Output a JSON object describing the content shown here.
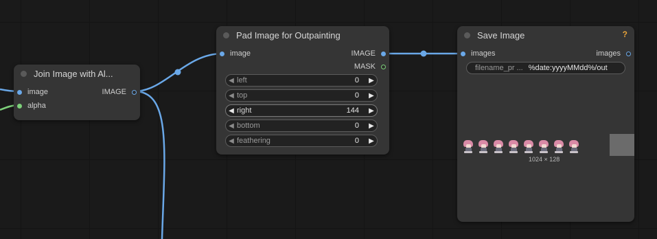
{
  "nodes": {
    "join": {
      "title": "Join Image with Al...",
      "inputs": [
        {
          "name": "image",
          "color": "#6aa8e8"
        },
        {
          "name": "alpha",
          "color": "#7dd07a"
        }
      ],
      "outputs": [
        {
          "name": "IMAGE",
          "color": "#6aa8e8"
        }
      ]
    },
    "pad": {
      "title": "Pad Image for Outpainting",
      "inputs": [
        {
          "name": "image",
          "color": "#6aa8e8"
        }
      ],
      "outputs": [
        {
          "name": "IMAGE",
          "color": "#6aa8e8"
        },
        {
          "name": "MASK",
          "color": "#7dd07a"
        }
      ],
      "widgets": [
        {
          "label": "left",
          "value": "0"
        },
        {
          "label": "top",
          "value": "0"
        },
        {
          "label": "right",
          "value": "144"
        },
        {
          "label": "bottom",
          "value": "0"
        },
        {
          "label": "feathering",
          "value": "0"
        }
      ]
    },
    "save": {
      "title": "Save Image",
      "help": "?",
      "inputs": [
        {
          "name": "images",
          "color": "#6aa8e8"
        }
      ],
      "outputs": [
        {
          "name": "images",
          "color": "#6aa8e8"
        }
      ],
      "filename_prefix": {
        "label": "filename_pr ...",
        "value": "%date:yyyyMMdd%/out"
      },
      "preview_caption": "1024 × 128"
    }
  },
  "colors": {
    "image_link": "#6aa8e8",
    "mask_link": "#7dd07a",
    "help_accent": "#e8a33a",
    "node_bg": "#353535",
    "canvas_bg": "#1a1a1a"
  }
}
